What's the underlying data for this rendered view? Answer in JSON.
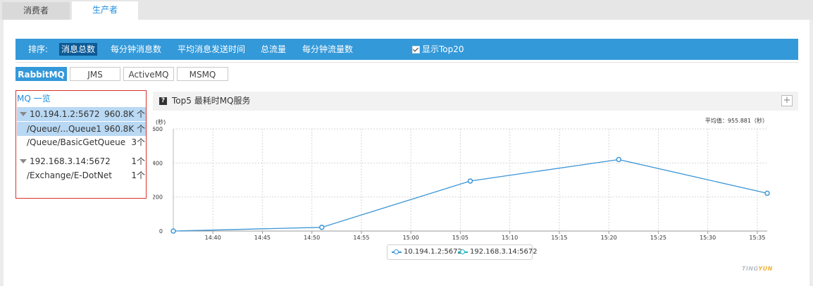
{
  "tabs": [
    {
      "label": "消费者",
      "active": false
    },
    {
      "label": "生产者",
      "active": true
    }
  ],
  "sortbar": {
    "label": "排序:",
    "options": [
      "消息总数",
      "每分钟消息数",
      "平均消息发送时间",
      "总流量",
      "每分钟流量数"
    ],
    "selected": "消息总数",
    "checkbox_label": "显示Top20",
    "checkbox_checked": true
  },
  "mq_types": [
    "RabbitMQ",
    "JMS",
    "ActiveMQ",
    "MSMQ"
  ],
  "mq_type_selected": "RabbitMQ",
  "tree": {
    "title": "MQ 一览",
    "nodes": [
      {
        "name": "10.194.1.2:5672",
        "count": "960.8K 个",
        "level": 0,
        "highlight": true,
        "expanded": true
      },
      {
        "name": "/Queue/...Queue1",
        "count": "960.8K 个",
        "level": 1,
        "highlight": true
      },
      {
        "name": "/Queue/BasicGetQueue",
        "count": "3个",
        "level": 1,
        "highlight": false
      },
      {
        "name": "192.168.3.14:5672",
        "count": "1个",
        "level": 0,
        "highlight": false,
        "expanded": true
      },
      {
        "name": "/Exchange/E-DotNet",
        "count": "1个",
        "level": 1,
        "highlight": false
      }
    ]
  },
  "chart_header": {
    "title": "Top5 最耗时MQ服务",
    "help_icon": "?",
    "expand_icon": "+"
  },
  "brand": {
    "part1": "TING",
    "part2": "YUN"
  },
  "chart_data": {
    "type": "line",
    "ylabel": "(秒)",
    "avg_label": "平均值：955.881（秒）",
    "ylim": [
      0,
      600
    ],
    "yticks": [
      0,
      200,
      400,
      600
    ],
    "xlim": [
      "14:36",
      "15:36"
    ],
    "xticks": [
      "14:40",
      "14:45",
      "14:50",
      "14:55",
      "15:00",
      "15:05",
      "15:10",
      "15:15",
      "15:20",
      "15:25",
      "15:30",
      "15:35"
    ],
    "grid": true,
    "legend_position": "bottom",
    "series": [
      {
        "name": "10.194.1.2:5672",
        "color": "#3d96d6",
        "x": [
          "14:36",
          "14:51",
          "15:06",
          "15:21",
          "15:36"
        ],
        "values": [
          0,
          22,
          294,
          420,
          222
        ]
      },
      {
        "name": "192.168.3.14:5672",
        "color": "#1bb6c1",
        "x": [],
        "values": []
      }
    ]
  }
}
